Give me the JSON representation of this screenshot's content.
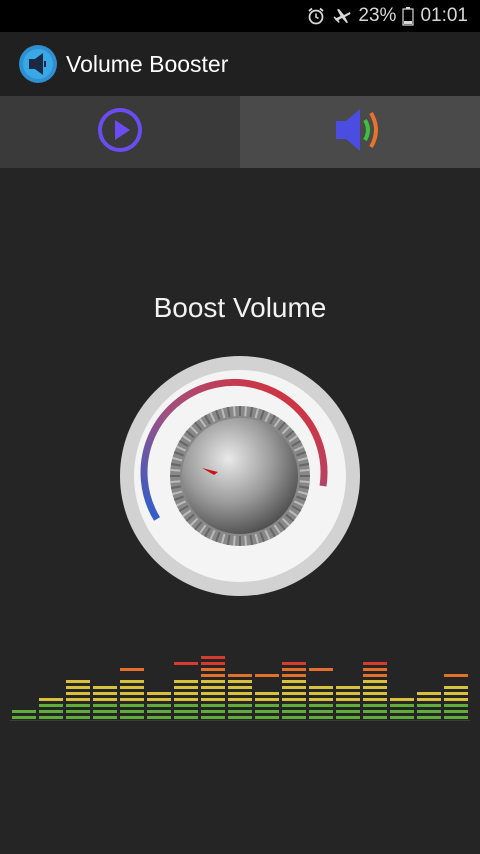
{
  "status_bar": {
    "battery": "23%",
    "time": "01:01",
    "icons": [
      "alarm-icon",
      "airplane-mode-icon",
      "battery-icon"
    ]
  },
  "app_bar": {
    "title": "Volume Booster",
    "logo": "volume-booster-logo-icon"
  },
  "tabs": [
    {
      "name": "player",
      "icon": "play-icon",
      "selected": false
    },
    {
      "name": "booster",
      "icon": "speaker-icon",
      "selected": true
    }
  ],
  "booster": {
    "heading": "Boost Volume",
    "knob_level": 0.0
  },
  "equalizer": {
    "levels": [
      2,
      4,
      7,
      6,
      7,
      5,
      7,
      11,
      8,
      5,
      10,
      6,
      6,
      10,
      4,
      5,
      6
    ],
    "peaks": [
      null,
      null,
      null,
      null,
      8,
      null,
      9,
      null,
      null,
      7,
      null,
      8,
      null,
      null,
      null,
      null,
      7
    ],
    "colors": {
      "low": "#5fae3a",
      "mid": "#d8c23a",
      "high": "#e2702a",
      "top": "#d93a2e"
    }
  },
  "colors": {
    "accent_purple": "#6a4df0",
    "speaker_blue": "#4a4de0",
    "wave_green": "#3fbf3f",
    "wave_orange": "#e8732a"
  }
}
